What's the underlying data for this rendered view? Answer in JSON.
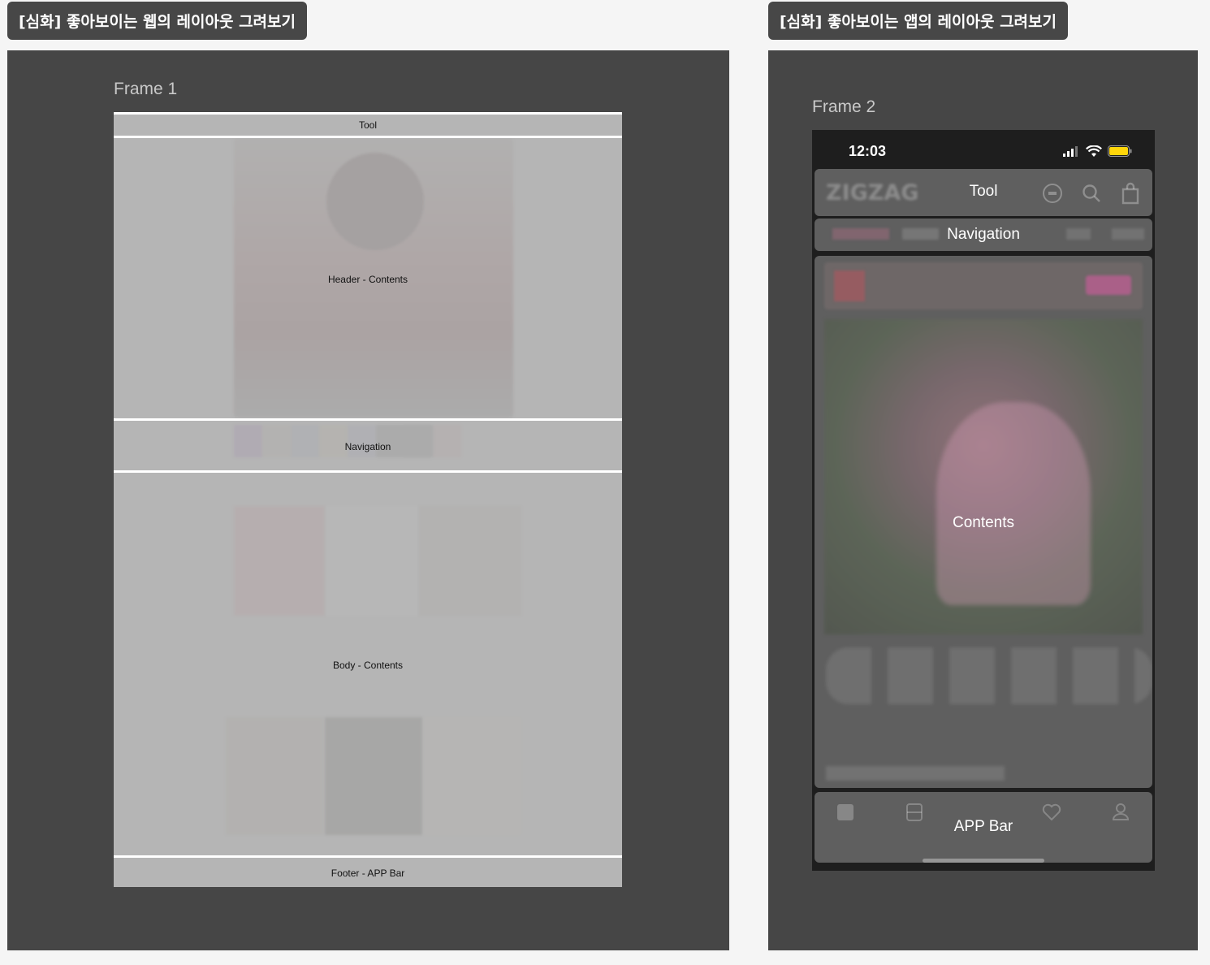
{
  "labels": {
    "web_section": "[심화] 좋아보이는 웹의 레이아웃 그려보기",
    "app_section": "[심화] 좋아보이는 앱의 레이아웃 그려보기"
  },
  "frame1": {
    "title": "Frame 1",
    "regions": {
      "tool": "Tool",
      "header": "Header - Contents",
      "navigation": "Navigation",
      "body": "Body - Contents",
      "footer": "Footer - APP Bar"
    }
  },
  "frame2": {
    "title": "Frame 2",
    "status_time": "12:03",
    "regions": {
      "tool": "Tool",
      "navigation": "Navigation",
      "contents": "Contents",
      "app_bar": "APP Bar"
    },
    "brand": "ZIGZAG"
  },
  "colors": {
    "board": "#464646",
    "label_bg": "#474747",
    "battery": "#ffd60a"
  }
}
